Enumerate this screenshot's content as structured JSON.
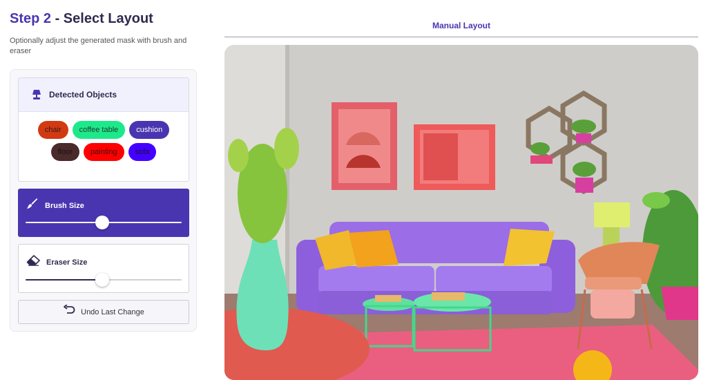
{
  "header": {
    "step_label": "Step 2",
    "title_rest": " - Select Layout",
    "description": "Optionally adjust the generated mask with brush and eraser"
  },
  "detected_objects": {
    "title": "Detected Objects",
    "icon": "lamp-icon",
    "chips": [
      {
        "label": "chair",
        "color": "#d13a12",
        "text_color": "#3a1a10"
      },
      {
        "label": "coffee table",
        "color": "#1de98b",
        "text_color": "#1f3a2c"
      },
      {
        "label": "cushion",
        "color": "#4a35b0",
        "text_color": "#ffffff"
      },
      {
        "label": "floor",
        "color": "#4a2a2a",
        "text_color": "#1a1010"
      },
      {
        "label": "painting",
        "color": "#ff0000",
        "text_color": "#3a1010"
      },
      {
        "label": "sofa",
        "color": "#4400ff",
        "text_color": "#1a1030"
      }
    ]
  },
  "brush": {
    "label": "Brush Size",
    "icon": "brush-icon",
    "value_fraction": 0.49
  },
  "eraser": {
    "label": "Eraser Size",
    "icon": "eraser-icon",
    "value_fraction": 0.49
  },
  "undo": {
    "label": "Undo Last Change",
    "icon": "undo-icon"
  },
  "layout_tab": {
    "label": "Manual Layout"
  },
  "colors": {
    "accent": "#4a35b0",
    "title_dark": "#2f2a4f"
  }
}
